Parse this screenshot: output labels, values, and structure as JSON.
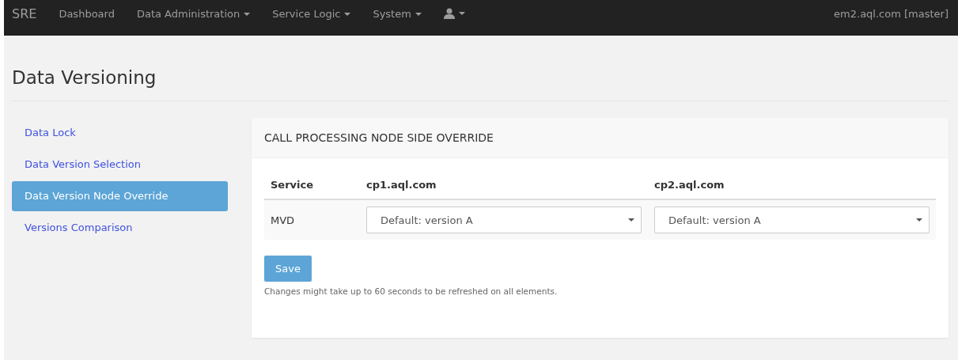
{
  "navbar": {
    "brand": "SRE",
    "items": [
      {
        "kind": "link",
        "label": "Dashboard",
        "dropdown": false
      },
      {
        "kind": "link",
        "label": "Data Administration",
        "dropdown": true
      },
      {
        "kind": "link",
        "label": "Service Logic",
        "dropdown": true
      },
      {
        "kind": "link",
        "label": "System",
        "dropdown": true
      },
      {
        "kind": "user",
        "dropdown": true
      }
    ],
    "server": "em2.aql.com [master]"
  },
  "page_title": "Data Versioning",
  "sidebar": {
    "items": [
      {
        "label": "Data Lock",
        "selected": false
      },
      {
        "label": "Data Version Selection",
        "selected": false
      },
      {
        "label": "Data Version Node Override",
        "selected": true
      },
      {
        "label": "Versions Comparison",
        "selected": false
      }
    ]
  },
  "panel": {
    "title": "CALL PROCESSING NODE SIDE OVERRIDE",
    "table": {
      "columns": [
        "Service",
        "cp1.aql.com",
        "cp2.aql.com"
      ],
      "rows": [
        {
          "service": "MVD",
          "selects": [
            "Default: version A",
            "Default: version A"
          ]
        }
      ]
    },
    "save_button": "Save",
    "help": "Changes might take up to 60 seconds to be refreshed on all elements."
  }
}
